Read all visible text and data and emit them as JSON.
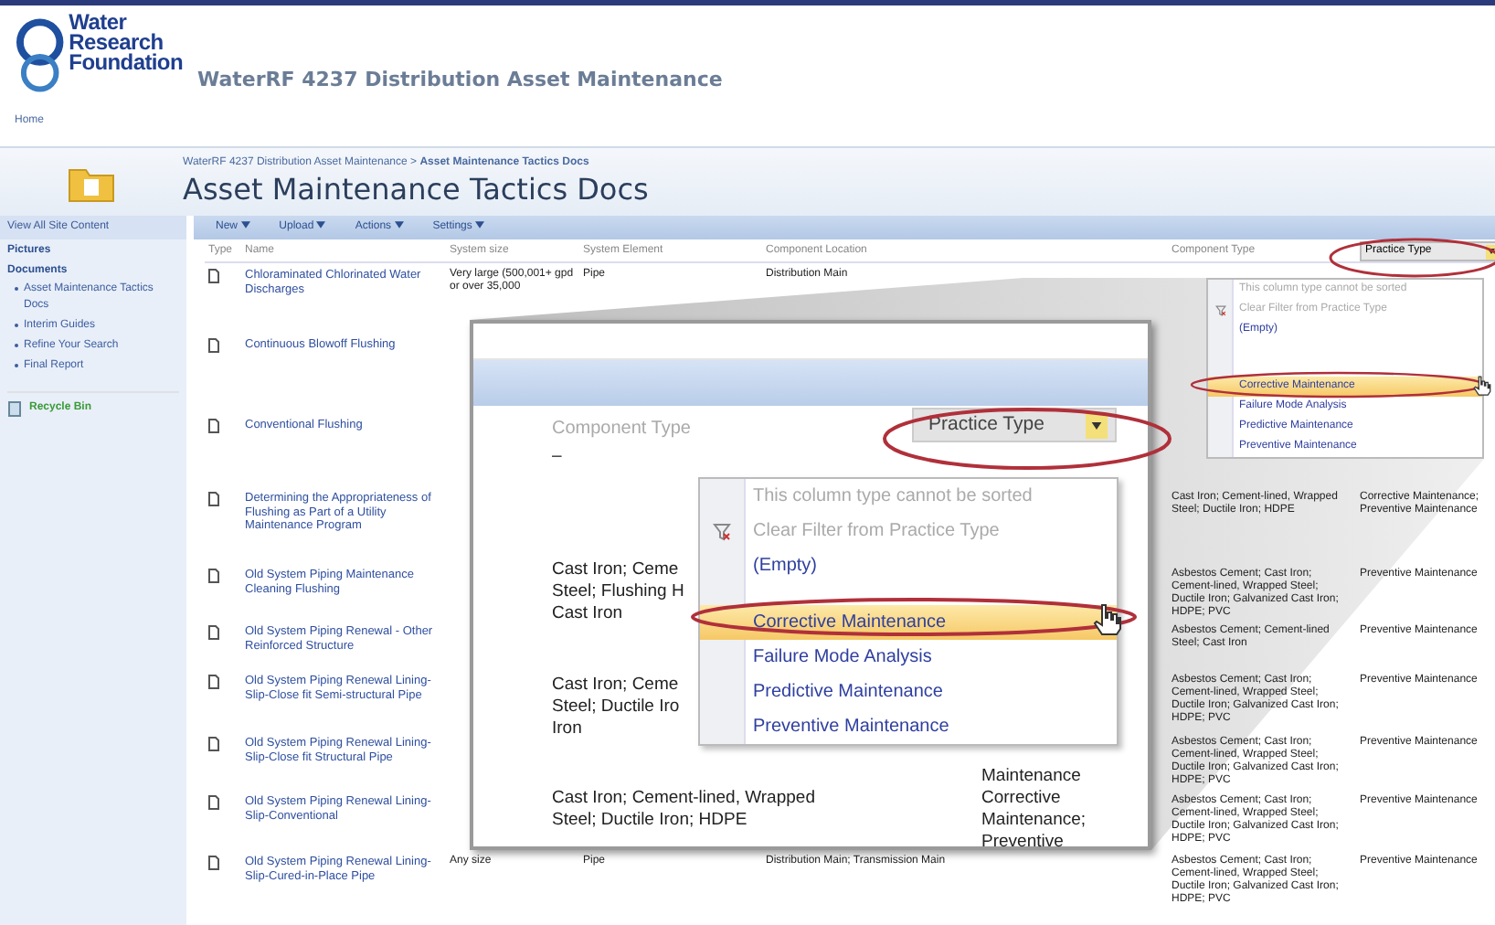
{
  "header": {
    "logo_lines": [
      "Water",
      "Research",
      "Foundation"
    ],
    "site_title": "WaterRF 4237 Distribution Asset Maintenance",
    "home_tab": "Home"
  },
  "breadcrumb": "WaterRF 4237 Distribution Asset Maintenance > **Asset Maintenance Tactics Docs**",
  "page_title": "Asset Maintenance Tactics Docs",
  "sidebar": {
    "view_all": "View All Site Content",
    "sections": [
      {
        "heading": "Pictures"
      },
      {
        "heading": "Documents",
        "items": [
          "Asset Maintenance Tactics Docs",
          "Interim Guides",
          "Refine Your Search",
          "Final Report"
        ]
      }
    ],
    "recycle_bin": "Recycle Bin"
  },
  "toolbar": [
    "New",
    "Upload",
    "Actions",
    "Settings"
  ],
  "table": {
    "columns": [
      "Type",
      "Name",
      "System size",
      "System Element",
      "Component Location",
      "Component Type",
      "Practice Type"
    ],
    "rows": [
      {
        "name": "Chloraminated Chlorinated Water Discharges",
        "system_size": "Very large (500,001+ gpd or over 35,000",
        "system_element": "Pipe",
        "component_location": "Distribution Main"
      },
      {
        "name": "Continuous Blowoff Flushing"
      },
      {
        "name": "Conventional Flushing"
      },
      {
        "name": "Determining the Appropriateness of Flushing as Part of a Utility Maintenance Program",
        "component_type": "Cast Iron; Cement-lined, Wrapped Steel; Ductile Iron; HDPE",
        "practice_type": "Corrective Maintenance; Preventive Maintenance"
      },
      {
        "name": "Old System Piping Maintenance Cleaning Flushing",
        "component_type": "Asbestos Cement; Cast Iron; Cement-lined, Wrapped Steel; Ductile Iron; Galvanized Cast Iron; HDPE; PVC",
        "practice_type": "Preventive Maintenance"
      },
      {
        "name": "Old System Piping Renewal - Other Reinforced Structure",
        "component_type": "Asbestos Cement; Cement-lined Steel; Cast Iron",
        "practice_type": "Preventive Maintenance"
      },
      {
        "name": "Old System Piping Renewal Lining-Slip-Close fit Semi-structural Pipe",
        "component_type": "Asbestos Cement; Cast Iron; Cement-lined, Wrapped Steel; Ductile Iron; Galvanized Cast Iron; HDPE; PVC",
        "practice_type": "Preventive Maintenance"
      },
      {
        "name": "Old System Piping Renewal Lining-Slip-Close fit Structural Pipe",
        "component_type": "Asbestos Cement; Cast Iron; Cement-lined, Wrapped Steel; Ductile Iron; Galvanized Cast Iron; HDPE; PVC",
        "practice_type": "Preventive Maintenance"
      },
      {
        "name": "Old System Piping Renewal Lining-Slip-Conventional",
        "component_type": "Asbestos Cement; Cast Iron; Cement-lined, Wrapped Steel; Ductile Iron; Galvanized Cast Iron; HDPE; PVC",
        "practice_type": "Preventive Maintenance"
      },
      {
        "name": "Old System Piping Renewal Lining-Slip-Cured-in-Place Pipe",
        "system_size": "Any size",
        "system_element": "Pipe",
        "component_location": "Distribution Main; Transmission Main",
        "component_type": "Asbestos Cement; Cast Iron; Cement-lined, Wrapped Steel; Ductile Iron; Galvanized Cast Iron; HDPE; PVC",
        "practice_type": "Preventive Maintenance"
      }
    ],
    "filter_menu": {
      "items": [
        {
          "label": "This column type cannot be sorted",
          "disabled": true,
          "selected": false
        },
        {
          "label": "Clear Filter from Practice Type",
          "disabled": true,
          "selected": false
        },
        {
          "label": "(Empty)",
          "disabled": false,
          "selected": false
        },
        {
          "label": "Corrective Maintenance",
          "disabled": false,
          "selected": true
        },
        {
          "label": "Failure Mode Analysis",
          "disabled": false,
          "selected": false
        },
        {
          "label": "Predictive Maintenance",
          "disabled": false,
          "selected": false
        },
        {
          "label": "Preventive Maintenance",
          "disabled": false,
          "selected": false
        }
      ]
    }
  },
  "callout": {
    "column_label": "Component Type",
    "filter_button": "Practice Type",
    "rows": [
      {
        "component_type": [
          "–"
        ]
      },
      {
        "component_type": [
          "Cast Iron; Ceme",
          "Steel; Flushing H",
          "Cast Iron"
        ]
      },
      {
        "component_type": [
          "Cast Iron; Ceme",
          "Steel; Ductile Iro",
          "Iron"
        ],
        "practice_type": [
          "Maintenance"
        ]
      },
      {
        "component_type": [
          "Cast Iron; Cement-lined, Wrapped",
          "Steel; Ductile Iron; HDPE"
        ],
        "practice_type": [
          "Corrective",
          "Maintenance;",
          "Preventive"
        ]
      }
    ],
    "menu": {
      "items": [
        {
          "label": "This column type cannot be sorted",
          "disabled": true,
          "selected": false
        },
        {
          "label": "Clear Filter from Practice Type",
          "disabled": true,
          "selected": false
        },
        {
          "label": "(Empty)",
          "disabled": false,
          "selected": false
        },
        {
          "label": "Corrective Maintenance",
          "disabled": false,
          "selected": true
        },
        {
          "label": "Failure Mode Analysis",
          "disabled": false,
          "selected": false
        },
        {
          "label": "Predictive Maintenance",
          "disabled": false,
          "selected": false
        },
        {
          "label": "Preventive Maintenance",
          "disabled": false,
          "selected": false
        }
      ]
    }
  }
}
